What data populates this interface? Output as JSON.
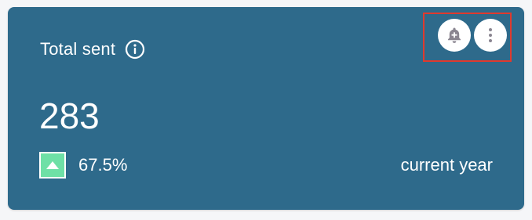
{
  "card": {
    "title": "Total sent",
    "value": "283",
    "change_percent": "67.5%",
    "trend_direction": "up",
    "period": "current year"
  },
  "icons": {
    "info": "info-icon",
    "trend": "triangle-up-icon",
    "alert": "bell-plus-icon",
    "menu": "more-vertical-icon"
  },
  "colors": {
    "card_background": "#2e6a8b",
    "trend_up": "#6ee0a6",
    "highlight": "#e03a2e",
    "icon_gray": "#8a8590"
  }
}
